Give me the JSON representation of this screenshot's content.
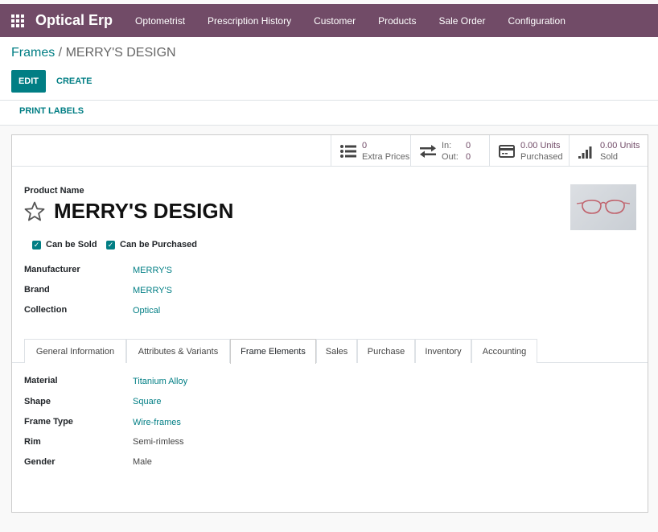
{
  "app": {
    "name": "Optical Erp"
  },
  "nav": {
    "items": [
      "Optometrist",
      "Prescription History",
      "Customer",
      "Products",
      "Sale Order",
      "Configuration"
    ]
  },
  "breadcrumb": {
    "parent": "Frames",
    "separator": " / ",
    "current": "MERRY'S DESIGN"
  },
  "buttons": {
    "edit": "EDIT",
    "create": "CREATE",
    "print_labels": "PRINT LABELS"
  },
  "stats": {
    "extra_prices": {
      "value": "0",
      "label": "Extra Prices"
    },
    "in_out": {
      "in_label": "In:",
      "in_value": "0",
      "out_label": "Out:",
      "out_value": "0"
    },
    "purchased": {
      "value": "0.00 Units",
      "label": "Purchased"
    },
    "sold": {
      "value": "0.00 Units",
      "label": "Sold"
    }
  },
  "product": {
    "name_label": "Product Name",
    "name": "MERRY'S DESIGN",
    "can_be_sold": "Can be Sold",
    "can_be_purchased": "Can be Purchased"
  },
  "fields": [
    {
      "label": "Manufacturer",
      "value": "MERRY'S"
    },
    {
      "label": "Brand",
      "value": "MERRY'S"
    },
    {
      "label": "Collection",
      "value": "Optical"
    }
  ],
  "tabs": [
    "General Information",
    "Attributes & Variants",
    "Frame Elements",
    "Sales",
    "Purchase",
    "Inventory",
    "Accounting"
  ],
  "active_tab": "Frame Elements",
  "frame_elements": [
    {
      "label": "Material",
      "value": "Titanium Alloy"
    },
    {
      "label": "Shape",
      "value": "Square"
    },
    {
      "label": "Frame Type",
      "value": "Wire-frames"
    },
    {
      "label": "Rim",
      "value": "Semi-rimless"
    },
    {
      "label": "Gender",
      "value": "Male"
    }
  ],
  "colors": {
    "brand": "#714b67",
    "accent": "#017e84"
  }
}
